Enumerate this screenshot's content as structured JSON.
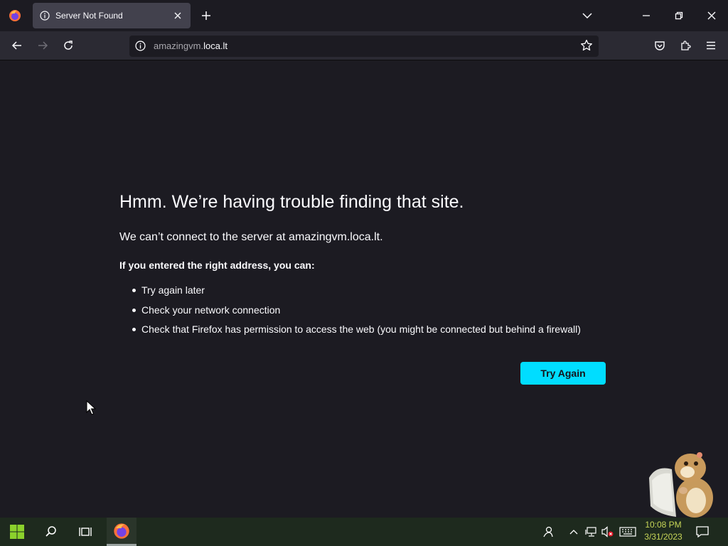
{
  "browser": {
    "tab": {
      "title": "Server Not Found"
    },
    "url": {
      "host_prefix": "amazingvm.",
      "host_domain": "loca.lt"
    }
  },
  "error_page": {
    "title": "Hmm. We’re having trouble finding that site.",
    "description": "We can’t connect to the server at amazingvm.loca.lt.",
    "subtitle": "If you entered the right address, you can:",
    "suggestions": [
      "Try again later",
      "Check your network connection",
      "Check that Firefox has permission to access the web (you might be connected but behind a firewall)"
    ],
    "try_again_label": "Try Again"
  },
  "taskbar": {
    "clock": {
      "time": "10:08 PM",
      "date": "3/31/2023"
    }
  },
  "colors": {
    "accent": "#00ddff",
    "page_bg": "#1c1b22",
    "toolbar_bg": "#2b2a33",
    "tab_bg": "#42414d",
    "clock_text": "#c7d657"
  },
  "icons": [
    "firefox-icon",
    "info-icon",
    "close-icon",
    "plus-icon",
    "chevron-down-icon",
    "minimize-icon",
    "restore-icon",
    "back-icon",
    "forward-icon",
    "reload-icon",
    "star-icon",
    "pocket-icon",
    "extensions-icon",
    "menu-icon",
    "windows-start-icon",
    "search-icon",
    "task-view-icon",
    "people-icon",
    "chevron-up-icon",
    "network-icon",
    "volume-muted-icon",
    "keyboard-icon",
    "notification-icon"
  ]
}
